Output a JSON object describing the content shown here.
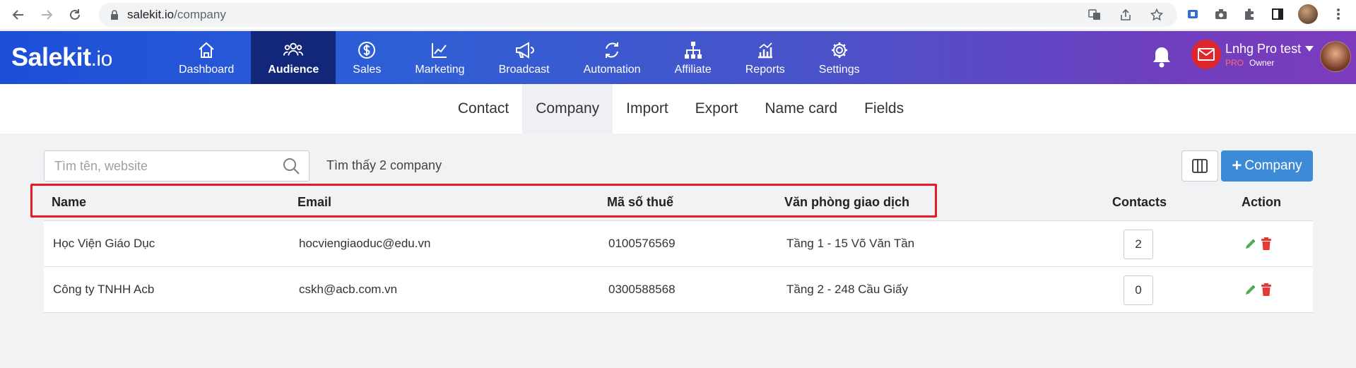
{
  "browser": {
    "url_host": "salekit.io",
    "url_path": "/company"
  },
  "header": {
    "logo_main": "Salekit",
    "logo_suffix": ".io",
    "nav": [
      {
        "label": "Dashboard",
        "icon": "home-icon"
      },
      {
        "label": "Audience",
        "icon": "users-icon",
        "active": true
      },
      {
        "label": "Sales",
        "icon": "dollar-icon"
      },
      {
        "label": "Marketing",
        "icon": "trend-icon"
      },
      {
        "label": "Broadcast",
        "icon": "megaphone-icon"
      },
      {
        "label": "Automation",
        "icon": "cycle-icon"
      },
      {
        "label": "Affiliate",
        "icon": "network-icon"
      },
      {
        "label": "Reports",
        "icon": "chart-icon"
      },
      {
        "label": "Settings",
        "icon": "gear-icon"
      }
    ],
    "user": {
      "name": "Lnhg Pro test",
      "plan": "PRO",
      "role": "Owner"
    }
  },
  "subtabs": [
    "Contact",
    "Company",
    "Import",
    "Export",
    "Name card",
    "Fields"
  ],
  "active_subtab": "Company",
  "toolbar": {
    "search_placeholder": "Tìm tên, website",
    "found_text": "Tìm thấy 2 company",
    "add_label": "Company"
  },
  "table": {
    "headers": {
      "name": "Name",
      "email": "Email",
      "tax": "Mã số thuế",
      "office": "Văn phòng giao dịch",
      "contacts": "Contacts",
      "action": "Action"
    },
    "rows": [
      {
        "name": "Học Viện Giáo Dục",
        "email": "hocviengiaoduc@edu.vn",
        "tax": "0100576569",
        "office": "Tầng 1 - 15 Võ Văn Tần",
        "contacts": "2"
      },
      {
        "name": "Công ty TNHH Acb",
        "email": "cskh@acb.com.vn",
        "tax": "0300588568",
        "office": "Tầng 2 - 248 Cầu Giấy",
        "contacts": "0"
      }
    ]
  },
  "colors": {
    "accent_blue": "#3d8ad6",
    "highlight_red": "#e51c23",
    "edit_green": "#4caf50",
    "delete_red": "#e53935"
  }
}
